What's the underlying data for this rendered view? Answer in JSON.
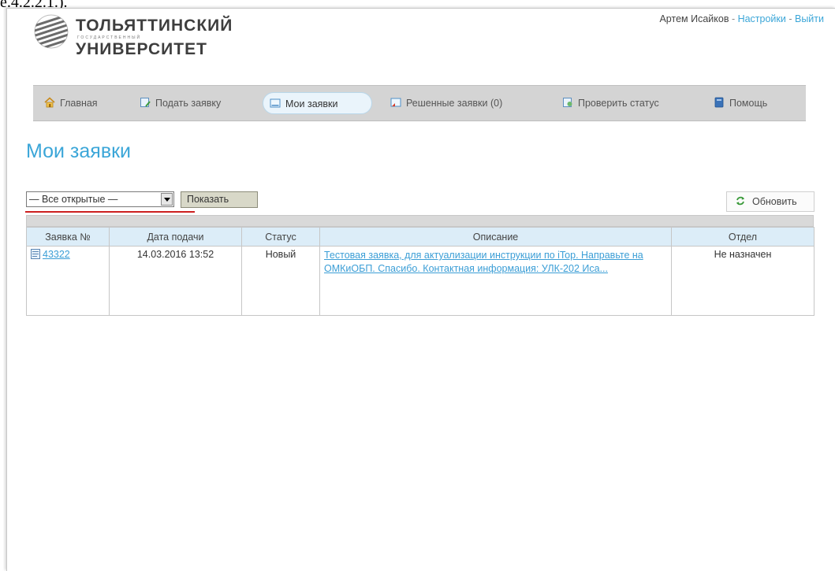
{
  "crop_text": "е.4.2.2.1.).",
  "logo": {
    "line1": "ТОЛЬЯТТИНСКИЙ",
    "sub": "ГОСУДАРСТВЕННЫЙ",
    "line2": "УНИВЕРСИТЕТ"
  },
  "userbar": {
    "user_name": "Артем Исайков",
    "separator": " - ",
    "settings": "Настройки",
    "logout": "Выйти"
  },
  "nav": {
    "items": [
      {
        "label": "Главная",
        "icon": "home-icon"
      },
      {
        "label": "Подать заявку",
        "icon": "new-request-icon"
      },
      {
        "label": "Мои заявки",
        "icon": "my-requests-icon"
      },
      {
        "label": "Решенные заявки (0)",
        "icon": "resolved-requests-icon"
      },
      {
        "label": "Проверить статус",
        "icon": "check-status-icon"
      },
      {
        "label": "Помощь",
        "icon": "help-book-icon"
      }
    ],
    "active_index": 2
  },
  "page_title": "Мои заявки",
  "filter": {
    "selected": "— Все открытые —",
    "show_button": "Показать",
    "refresh_button": "Обновить"
  },
  "table": {
    "headers": [
      "Заявка №",
      "Дата подачи",
      "Статус",
      "Описание",
      "Отдел"
    ],
    "rows": [
      {
        "id": "43322",
        "date": "14.03.2016 13:52",
        "status": "Новый",
        "description": "Тестовая заявка, для актуализации инструкции по iTop. Направьте на ОМКиОБП. Спасибо. Контактная информация: УЛК-202 Иса...",
        "department": "Не назначен"
      }
    ]
  },
  "colors": {
    "accent": "#3ba6d8",
    "nav_bg": "#d4d4d4",
    "table_header_bg": "#dcedf8",
    "underline_red": "#cc2020"
  }
}
